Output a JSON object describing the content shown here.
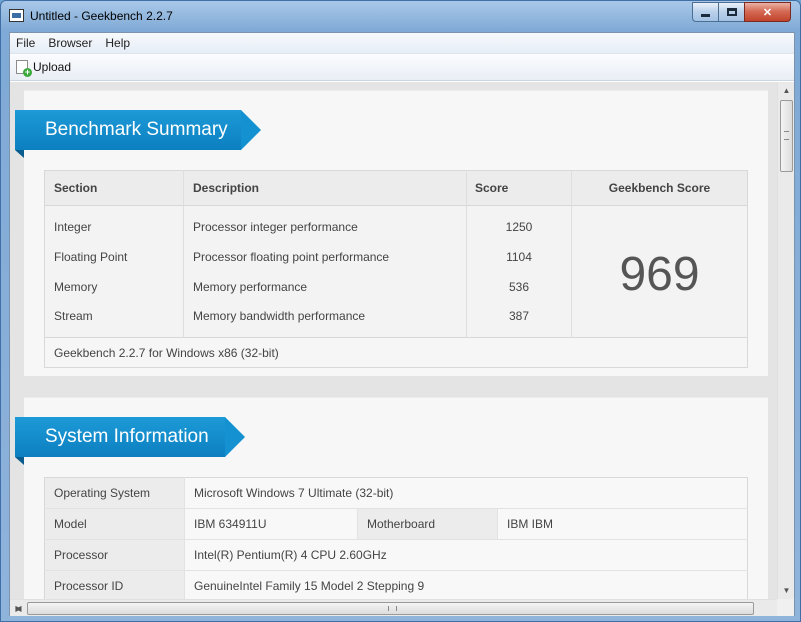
{
  "window": {
    "title": "Untitled - Geekbench 2.2.7",
    "controls": {
      "minimize": "minimize",
      "maximize": "maximize",
      "close": "✕"
    }
  },
  "menu": [
    "File",
    "Browser",
    "Help"
  ],
  "toolbar": {
    "upload_label": "Upload"
  },
  "summary": {
    "heading": "Benchmark Summary",
    "columns": {
      "section": "Section",
      "description": "Description",
      "score": "Score",
      "geekbench_score": "Geekbench Score"
    },
    "rows": [
      {
        "section": "Integer",
        "description": "Processor integer performance",
        "score": "1250"
      },
      {
        "section": "Floating Point",
        "description": "Processor floating point performance",
        "score": "1104"
      },
      {
        "section": "Memory",
        "description": "Memory performance",
        "score": "536"
      },
      {
        "section": "Stream",
        "description": "Memory bandwidth performance",
        "score": "387"
      }
    ],
    "geekbench_score": "969",
    "footer": "Geekbench 2.2.7 for Windows x86 (32-bit)"
  },
  "system": {
    "heading": "System Information",
    "operating_system": {
      "label": "Operating System",
      "value": "Microsoft Windows 7 Ultimate (32-bit)"
    },
    "model": {
      "label": "Model",
      "value": "IBM 634911U"
    },
    "motherboard": {
      "label": "Motherboard",
      "value": "IBM IBM"
    },
    "processor": {
      "label": "Processor",
      "value": "Intel(R) Pentium(R) 4 CPU 2.60GHz"
    },
    "processor_id": {
      "label": "Processor ID",
      "value": "GenuineIntel Family 15 Model 2 Stepping 9"
    }
  }
}
